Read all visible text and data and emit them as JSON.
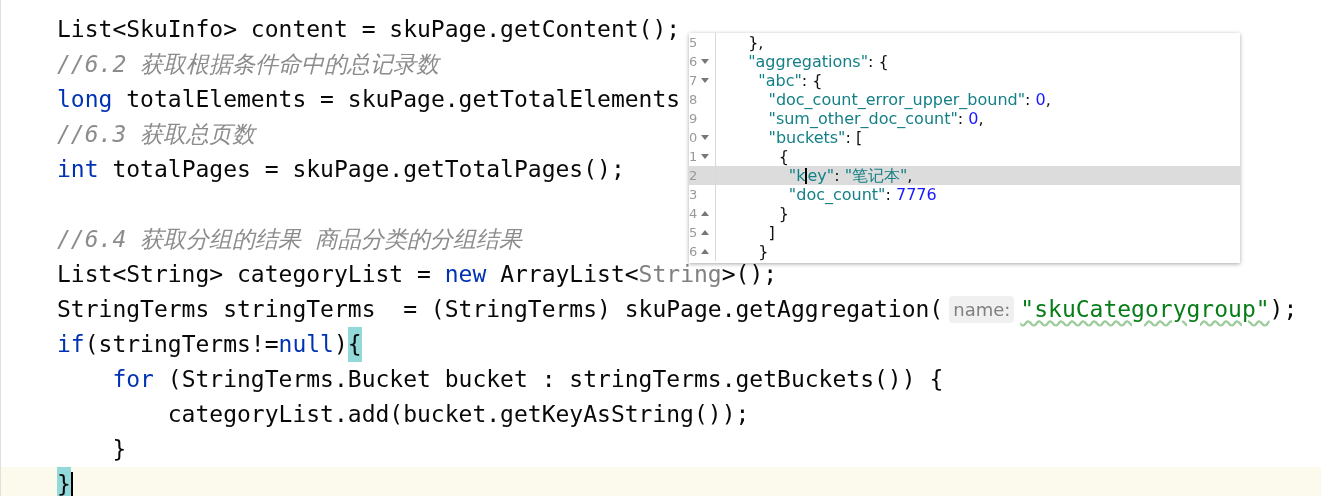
{
  "editor": {
    "lines": [
      {
        "current": false,
        "segments": [
          {
            "text": "List<SkuInfo> content = skuPage.getContent();",
            "kind": "plain"
          }
        ]
      },
      {
        "current": false,
        "segments": [
          {
            "text": "//6.2 获取根据条件命中的总记录数",
            "kind": "comment"
          }
        ]
      },
      {
        "current": false,
        "segments": [
          {
            "text": "long",
            "kind": "keyword"
          },
          {
            "text": " totalElements = skuPage.getTotalElements",
            "kind": "plain"
          }
        ]
      },
      {
        "current": false,
        "segments": [
          {
            "text": "//6.3 获取总页数",
            "kind": "comment"
          }
        ]
      },
      {
        "current": false,
        "segments": [
          {
            "text": "int",
            "kind": "keyword"
          },
          {
            "text": " totalPages = skuPage.getTotalPages();",
            "kind": "plain"
          }
        ]
      },
      {
        "current": false
      },
      {
        "current": false,
        "segments": [
          {
            "text": "//6.4 获取分组的结果 商品分类的分组结果",
            "kind": "comment"
          }
        ]
      },
      {
        "current": false,
        "segments": [
          {
            "text": "List<String> categoryList = ",
            "kind": "plain"
          },
          {
            "text": "new",
            "kind": "keyword"
          },
          {
            "text": " ArrayList<",
            "kind": "plain"
          },
          {
            "text": "String",
            "kind": "redundant"
          },
          {
            "text": ">();",
            "kind": "plain"
          }
        ]
      },
      {
        "current": false,
        "segments": [
          {
            "text": "StringTerms stringTerms  = (StringTerms) skuPage.getAggregation(",
            "kind": "plain"
          },
          {
            "text": "name:",
            "kind": "hint"
          },
          {
            "text": "\"skuCategorygroup\"",
            "kind": "string_typo"
          },
          {
            "text": ");",
            "kind": "plain"
          }
        ]
      },
      {
        "current": false,
        "segments": [
          {
            "text": "if",
            "kind": "keyword"
          },
          {
            "text": "(stringTerms!=",
            "kind": "plain"
          },
          {
            "text": "null",
            "kind": "keyword"
          },
          {
            "text": ")",
            "kind": "plain"
          },
          {
            "text": "{",
            "kind": "brace"
          }
        ]
      },
      {
        "current": false,
        "segments": [
          {
            "text": "    for",
            "kind": "keyword"
          },
          {
            "text": " (StringTerms.Bucket bucket : stringTerms.getBuckets()) {",
            "kind": "plain"
          }
        ]
      },
      {
        "current": false,
        "segments": [
          {
            "text": "        categoryList.add(bucket.getKeyAsString());",
            "kind": "plain"
          }
        ]
      },
      {
        "current": false,
        "segments": [
          {
            "text": "    }",
            "kind": "plain"
          }
        ]
      },
      {
        "current": true,
        "segments": [
          {
            "text": "}",
            "kind": "brace",
            "caret_after": true
          }
        ]
      }
    ]
  },
  "json_popup": {
    "lines": [
      {
        "number": "5",
        "fold_start": false,
        "fold_end": false,
        "selected": false,
        "segments": [
          {
            "text": "  },",
            "kind": "punct"
          }
        ]
      },
      {
        "number": "6",
        "fold_start": true,
        "fold_end": false,
        "selected": false,
        "segments": [
          {
            "text": "  \"aggregations\"",
            "kind": "key"
          },
          {
            "text": ": {",
            "kind": "punct"
          }
        ]
      },
      {
        "number": "7",
        "fold_start": true,
        "fold_end": false,
        "selected": false,
        "segments": [
          {
            "text": "    \"abc\"",
            "kind": "key"
          },
          {
            "text": ": {",
            "kind": "punct"
          }
        ]
      },
      {
        "number": "8",
        "fold_start": false,
        "fold_end": false,
        "selected": false,
        "segments": [
          {
            "text": "      \"doc_count_error_upper_bound\"",
            "kind": "key"
          },
          {
            "text": ": ",
            "kind": "punct"
          },
          {
            "text": "0",
            "kind": "number"
          },
          {
            "text": ",",
            "kind": "punct"
          }
        ]
      },
      {
        "number": "9",
        "fold_start": false,
        "fold_end": false,
        "selected": false,
        "segments": [
          {
            "text": "      \"sum_other_doc_count\"",
            "kind": "key"
          },
          {
            "text": ": ",
            "kind": "punct"
          },
          {
            "text": "0",
            "kind": "number"
          },
          {
            "text": ",",
            "kind": "punct"
          }
        ]
      },
      {
        "number": "0",
        "fold_start": true,
        "fold_end": false,
        "selected": false,
        "segments": [
          {
            "text": "      \"buckets\"",
            "kind": "key"
          },
          {
            "text": ": [",
            "kind": "punct"
          }
        ]
      },
      {
        "number": "1",
        "fold_start": true,
        "fold_end": false,
        "selected": false,
        "segments": [
          {
            "text": "        {",
            "kind": "punct"
          }
        ]
      },
      {
        "number": "2",
        "fold_start": false,
        "fold_end": false,
        "selected": true,
        "segments": [
          {
            "text": "          \"k",
            "kind": "key",
            "caret_after": true
          },
          {
            "text": "ey\"",
            "kind": "key"
          },
          {
            "text": ": ",
            "kind": "punct"
          },
          {
            "text": "\"笔记本\"",
            "kind": "key"
          },
          {
            "text": ",",
            "kind": "punct"
          }
        ]
      },
      {
        "number": "3",
        "fold_start": false,
        "fold_end": false,
        "selected": false,
        "segments": [
          {
            "text": "          \"doc_count\"",
            "kind": "key"
          },
          {
            "text": ": ",
            "kind": "punct"
          },
          {
            "text": "7776",
            "kind": "number"
          }
        ]
      },
      {
        "number": "4",
        "fold_start": false,
        "fold_end": true,
        "selected": false,
        "segments": [
          {
            "text": "        }",
            "kind": "punct"
          }
        ]
      },
      {
        "number": "5",
        "fold_start": false,
        "fold_end": true,
        "selected": false,
        "segments": [
          {
            "text": "      ]",
            "kind": "punct"
          }
        ]
      },
      {
        "number": "6",
        "fold_start": false,
        "fold_end": true,
        "selected": false,
        "segments": [
          {
            "text": "    }",
            "kind": "punct"
          }
        ]
      }
    ]
  }
}
